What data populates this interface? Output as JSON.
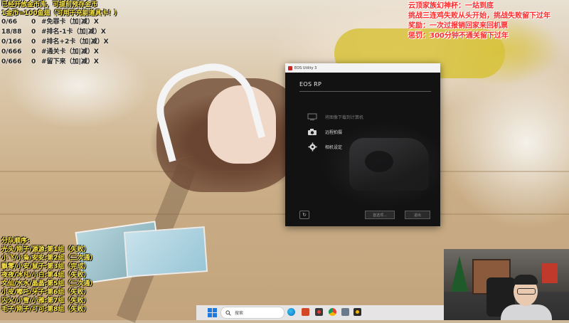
{
  "overlay_top_left": {
    "line1": "已经开放金币库，可提前预存金币",
    "line2": "1金币=100鱼翅（可用于充能道具卡！）",
    "rows": [
      {
        "count": "0/66",
        "value": "0",
        "label": "#免罪卡（加|减）X"
      },
      {
        "count": "18/88",
        "value": "0",
        "label": "#排名-1卡（加|减）X"
      },
      {
        "count": "0/166",
        "value": "0",
        "label": "#排名+2卡（加|减）X"
      },
      {
        "count": "0/666",
        "value": "0",
        "label": "#通关卡（加|减）X"
      },
      {
        "count": "0/666",
        "value": "0",
        "label": "#留下来（加|减）X"
      }
    ]
  },
  "overlay_top_right": {
    "lines": [
      "云顶家族幻神杯：一站到底",
      "挑战三连鸡失败从头开始，挑战失败留下过年",
      "奖励：一次过报销回家来回机票",
      "惩罚：300分钟不通关留下过年"
    ]
  },
  "overlay_bottom_left": {
    "title": "分队顺序:",
    "rows": [
      "光头/刚子/源源:第1组（失败）",
      "小飞/小枭/安安:第2组（二次通）",
      "飘零/小安/鼠子:第3组（完成）",
      "夜夜/冰凡/小白:第4组（失败）",
      "文仙/水水/晶晶:第5组（二次通）",
      "小皮/嘟吒/牙子:第6组（失败）",
      "闪火/小雪/小雅:第7组（失败）",
      "毛子/刚子/可可:第8组（失败）"
    ]
  },
  "eos_window": {
    "title": "EOS Utility 3",
    "model": "EOS RP",
    "menu": [
      {
        "label": "将图像下载到计算机",
        "icon": "computer-download-icon",
        "enabled": false
      },
      {
        "label": "远程拍摄",
        "icon": "camera-icon",
        "enabled": true
      },
      {
        "label": "相机设定",
        "icon": "gear-icon",
        "enabled": true
      }
    ],
    "buttons": {
      "preferences": "首选项...",
      "exit": "退出"
    },
    "refresh_icon": "refresh-icon"
  },
  "taskbar": {
    "search_placeholder": "搜索",
    "apps": [
      "edge-icon",
      "powerpoint-icon",
      "app-red-icon",
      "chrome-icon",
      "file-icon",
      "app-yellow-icon"
    ]
  },
  "colors": {
    "overlay_yellow": "#ffe94a",
    "overlay_red": "#ff2a2a",
    "eos_dark": "#1a1a1b",
    "windows_blue": "#1f7ae0"
  }
}
